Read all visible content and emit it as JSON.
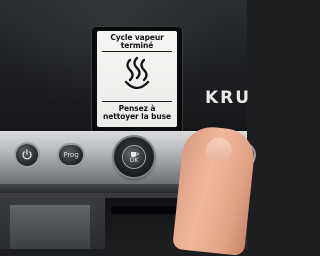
{
  "screen": {
    "line1": "Cycle vapeur",
    "line2": "terminé",
    "line3": "Pensez à",
    "line4": "nettoyer la buse",
    "icon": "steam-icon"
  },
  "brand": {
    "text": "KRU"
  },
  "buttons": {
    "power_icon": "power-icon",
    "prog_label": "Prog",
    "dial_icon": "cup-icon",
    "dial_label": "OK"
  },
  "colors": {
    "lcd_background": "#eef0ec",
    "panel": "#1f2124",
    "rail": "#b8bbbe"
  }
}
